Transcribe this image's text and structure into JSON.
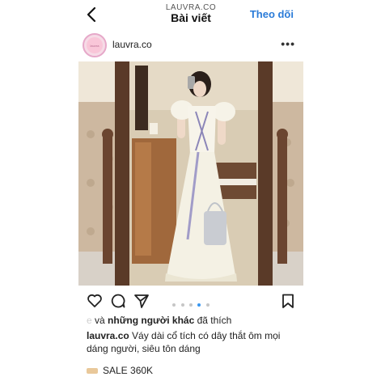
{
  "header": {
    "subtitle": "LAUVRA.CO",
    "title": "Bài viết",
    "follow_label": "Theo dõi"
  },
  "profile": {
    "username": "lauvra.co",
    "avatar_text": "lauvra"
  },
  "icons": {
    "back": "chevron-left-icon",
    "more": "more-horizontal-icon",
    "like": "heart-icon",
    "comment": "comment-icon",
    "share": "send-icon",
    "save": "bookmark-icon"
  },
  "carousel": {
    "total": 5,
    "active": 3
  },
  "likes": {
    "prefix": "e",
    "middle": " và ",
    "others": "những người khác",
    "suffix": " đã thích"
  },
  "caption": {
    "username": "lauvra.co",
    "text": " Váy dài cổ tích có dây thắt ôm mọi dáng người, siêu tôn dáng"
  },
  "sale": {
    "text": "SALE 360K"
  },
  "colors": {
    "accent": "#2a7bd8",
    "active_dot": "#3897f0"
  }
}
